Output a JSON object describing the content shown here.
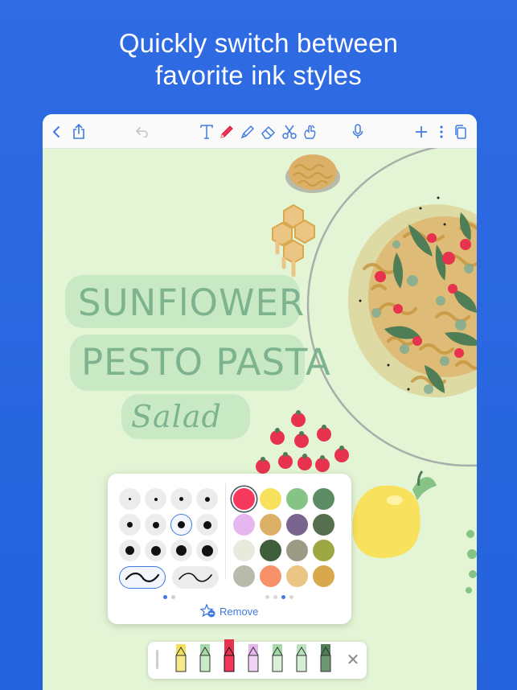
{
  "headline": {
    "line1": "Quickly switch between",
    "line2": "favorite ink styles"
  },
  "colors": {
    "background": "#2a67df",
    "canvas": "#e4f5d6",
    "accent": "#3f7ae0",
    "title_ink": "#7eb38f",
    "title_highlight": "#c9e9c5"
  },
  "toolbar": {
    "left_icons": [
      "back-chevron-icon",
      "share-icon",
      "undo-icon"
    ],
    "tool_icons": [
      "text-tool-icon",
      "pen-tool-icon",
      "highlighter-tool-icon",
      "eraser-tool-icon",
      "scissors-tool-icon",
      "touch-draw-icon"
    ],
    "right_icons": [
      "microphone-icon",
      "add-icon",
      "more-icon",
      "pages-icon"
    ]
  },
  "canvas": {
    "title_lines": [
      "SUNFlOWER",
      "PESTO PASTA",
      "Salad"
    ]
  },
  "palette": {
    "pen_sizes": [
      [
        1,
        2,
        3,
        4
      ],
      [
        5,
        6,
        7,
        8
      ],
      [
        9,
        10,
        11,
        12
      ]
    ],
    "selected_size_index": 6,
    "stroke_styles": [
      "smooth-curve",
      "pressure-curve"
    ],
    "selected_stroke": 0,
    "swatches": [
      "#f5385c",
      "#f8e15c",
      "#86c486",
      "#5c8c64",
      "#e6b7ee",
      "#ddb067",
      "#7a6591",
      "#56704f",
      "#e9eadb",
      "#3f5e3b",
      "#9c9c86",
      "#9ea843",
      "#b7bbaa",
      "#f7916a",
      "#ebc584",
      "#d9a84c"
    ],
    "selected_swatch": 0,
    "size_pages": 2,
    "size_page_current": 0,
    "color_pages": 4,
    "color_page_current": 2,
    "remove_label": "Remove"
  },
  "pencil_bar": {
    "pencils": [
      {
        "cap": "#f4e05e",
        "body": "#f6e98a",
        "selected": false
      },
      {
        "cap": "#a6d9a8",
        "body": "#c7ebc6",
        "selected": false
      },
      {
        "cap": "#e8334f",
        "body": "#f2375a",
        "selected": true
      },
      {
        "cap": "#e6b7ee",
        "body": "#efd3f4",
        "selected": false
      },
      {
        "cap": "#a6d9a8",
        "body": "#d9f1d7",
        "selected": false
      },
      {
        "cap": "#b9e2bf",
        "body": "#d5efd6",
        "selected": false
      },
      {
        "cap": "#4f7d56",
        "body": "#6b9870",
        "selected": false
      }
    ]
  }
}
